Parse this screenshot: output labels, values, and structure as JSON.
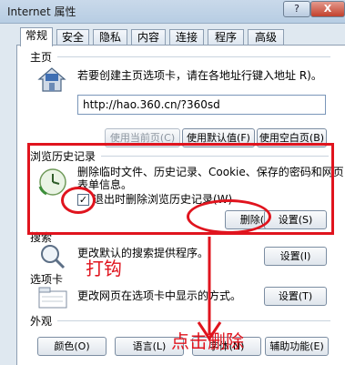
{
  "window": {
    "title": "Internet 属性",
    "help_label": "?",
    "close_label": "X"
  },
  "tabs": [
    "常规",
    "安全",
    "隐私",
    "内容",
    "连接",
    "程序",
    "高级"
  ],
  "home_page": {
    "group_label": "主页",
    "description": "若要创建主页选项卡，请在各地址行键入地址 R)。",
    "url": "http://hao.360.cn/?360sd",
    "buttons": {
      "use_current": "使用当前页(C)",
      "use_default": "使用默认值(F)",
      "use_blank": "使用空白页(B)"
    }
  },
  "history": {
    "group_label": "浏览历史记录",
    "description_line1": "删除临时文件、历史记录、Cookie、保存的密码和网页",
    "description_line2": "表单信息。",
    "checkbox_label": "退出时删除浏览历史记录(W)",
    "checkbox_checked": true,
    "delete_button": "删除(D)...",
    "settings_button": "设置(S)"
  },
  "search": {
    "group_label": "搜索",
    "description": "更改默认的搜索提供程序。",
    "settings_button": "设置(I)"
  },
  "tabs_section": {
    "group_label": "选项卡",
    "description": "更改网页在选项卡中显示的方式。",
    "settings_button": "设置(T)"
  },
  "appearance": {
    "group_label": "外观",
    "buttons": [
      "颜色(O)",
      "语言(L)",
      "字体(N)",
      "辅助功能(E)"
    ]
  },
  "annotations": {
    "check_hint": "打钩",
    "delete_hint": "点击删除"
  },
  "colors": {
    "annotation_red": "#e0141e",
    "panel_bg": "#ffffff",
    "window_bg": "#dfe8f0"
  }
}
